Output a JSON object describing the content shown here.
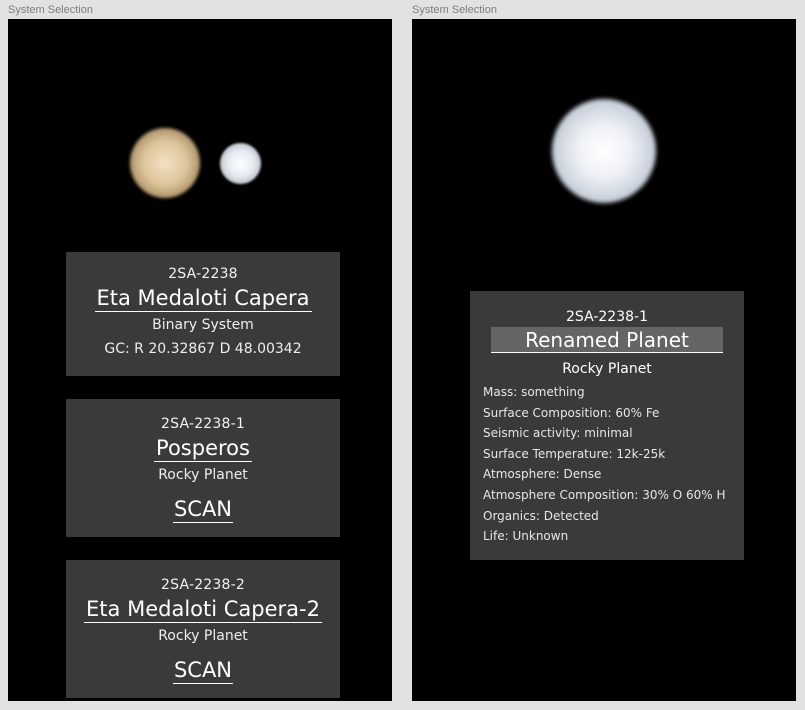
{
  "left_frame": {
    "label": "System Selection",
    "system": {
      "code": "2SA-2238",
      "name": "Eta Medaloti Capera",
      "type": "Binary System",
      "coords": "GC: R 20.32867 D 48.00342"
    },
    "planets": [
      {
        "code": "2SA-2238-1",
        "name": "Posperos",
        "type": "Rocky Planet",
        "action": "SCAN"
      },
      {
        "code": "2SA-2238-2",
        "name": "Eta Medaloti Capera-2",
        "type": "Rocky Planet",
        "action": "SCAN"
      }
    ]
  },
  "right_frame": {
    "label": "System Selection",
    "planet": {
      "code": "2SA-2238-1",
      "name_value": "Renamed Planet",
      "type": "Rocky Planet",
      "properties": [
        "Mass: something",
        "Surface Composition: 60% Fe",
        "Seismic activity: minimal",
        "Surface Temperature: 12k-25k",
        "Atmosphere: Dense",
        "Atmosphere Composition: 30% O 60% H",
        "Organics: Detected",
        "Life: Unknown"
      ]
    }
  },
  "colors": {
    "canvas_bg": "#e2e2e2",
    "screen_bg": "#000000",
    "card_bg": "#3a3a3a",
    "input_bg": "#656565",
    "text": "#ffffff"
  },
  "icons": [
    "primary-star-icon",
    "secondary-star-icon",
    "planet-icon"
  ]
}
